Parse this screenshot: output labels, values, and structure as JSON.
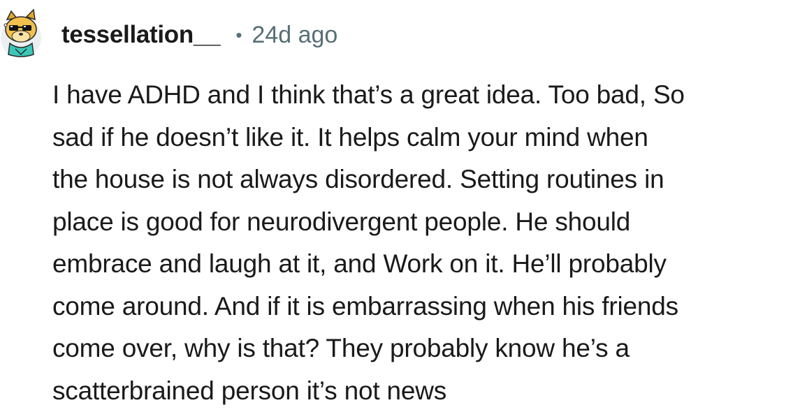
{
  "comment": {
    "username": "tessellation__",
    "separator": "•",
    "timestamp": "24d ago",
    "body_lines": [
      "I have ADHD and I think that’s a great idea. Too bad, So",
      "sad if he doesn’t like it. It helps calm your mind when",
      "the house is not always disordered. Setting routines in",
      "place is good for neurodivergent people. He should",
      "embrace and laugh at it, and Work on it. He’ll probably",
      "come around. And if it is embarrassing when his friends",
      "come over, why is that? They probably know he’s a",
      "scatterbrained person it’s not news"
    ],
    "avatar_icon": "snoo-avatar-dog-sunglasses-icon"
  }
}
